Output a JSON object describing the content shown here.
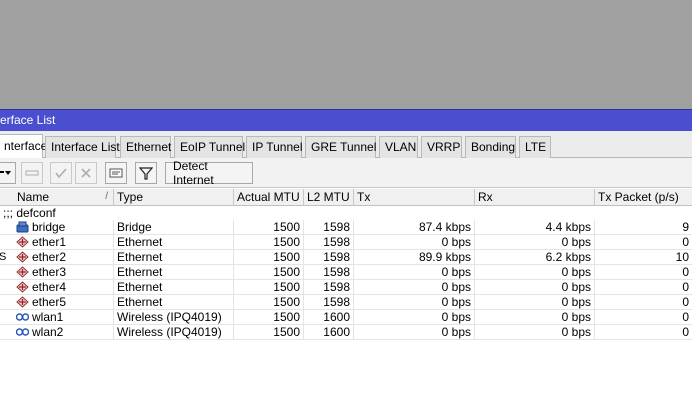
{
  "window": {
    "title": "erface List"
  },
  "tabs": [
    {
      "label": "nterface",
      "active": true
    },
    {
      "label": "Interface List",
      "active": false
    },
    {
      "label": "Ethernet",
      "active": false
    },
    {
      "label": "EoIP Tunnel",
      "active": false
    },
    {
      "label": "IP Tunnel",
      "active": false
    },
    {
      "label": "GRE Tunnel",
      "active": false
    },
    {
      "label": "VLAN",
      "active": false
    },
    {
      "label": "VRRP",
      "active": false
    },
    {
      "label": "Bonding",
      "active": false
    },
    {
      "label": "LTE",
      "active": false
    }
  ],
  "toolbar": {
    "detect_label": "Detect Internet"
  },
  "columns": {
    "name": "Name",
    "type": "Type",
    "actual_mtu": "Actual MTU",
    "l2_mtu": "L2 MTU",
    "tx": "Tx",
    "rx": "Rx",
    "tx_packet": "Tx Packet (p/s)"
  },
  "comment": ";;; defconf",
  "rows": [
    {
      "flag": "",
      "icon": "bridge-icon",
      "name": "bridge",
      "type": "Bridge",
      "actual_mtu": "1500",
      "l2_mtu": "1598",
      "tx": "87.4 kbps",
      "rx": "4.4 kbps",
      "tx_packet": "9"
    },
    {
      "flag": "",
      "icon": "ethernet-icon",
      "name": "ether1",
      "type": "Ethernet",
      "actual_mtu": "1500",
      "l2_mtu": "1598",
      "tx": "0 bps",
      "rx": "0 bps",
      "tx_packet": "0"
    },
    {
      "flag": "S",
      "icon": "ethernet-icon",
      "name": "ether2",
      "type": "Ethernet",
      "actual_mtu": "1500",
      "l2_mtu": "1598",
      "tx": "89.9 kbps",
      "rx": "6.2 kbps",
      "tx_packet": "10"
    },
    {
      "flag": "",
      "icon": "ethernet-icon",
      "name": "ether3",
      "type": "Ethernet",
      "actual_mtu": "1500",
      "l2_mtu": "1598",
      "tx": "0 bps",
      "rx": "0 bps",
      "tx_packet": "0"
    },
    {
      "flag": "",
      "icon": "ethernet-icon",
      "name": "ether4",
      "type": "Ethernet",
      "actual_mtu": "1500",
      "l2_mtu": "1598",
      "tx": "0 bps",
      "rx": "0 bps",
      "tx_packet": "0"
    },
    {
      "flag": "",
      "icon": "ethernet-icon",
      "name": "ether5",
      "type": "Ethernet",
      "actual_mtu": "1500",
      "l2_mtu": "1598",
      "tx": "0 bps",
      "rx": "0 bps",
      "tx_packet": "0"
    },
    {
      "flag": "",
      "icon": "wireless-icon",
      "name": "wlan1",
      "type": "Wireless (IPQ4019)",
      "actual_mtu": "1500",
      "l2_mtu": "1600",
      "tx": "0 bps",
      "rx": "0 bps",
      "tx_packet": "0"
    },
    {
      "flag": "",
      "icon": "wireless-icon",
      "name": "wlan2",
      "type": "Wireless (IPQ4019)",
      "actual_mtu": "1500",
      "l2_mtu": "1600",
      "tx": "0 bps",
      "rx": "0 bps",
      "tx_packet": "0"
    }
  ],
  "colors": {
    "title_bar": "#4a4fd0",
    "desktop": "#a0a0a0"
  }
}
